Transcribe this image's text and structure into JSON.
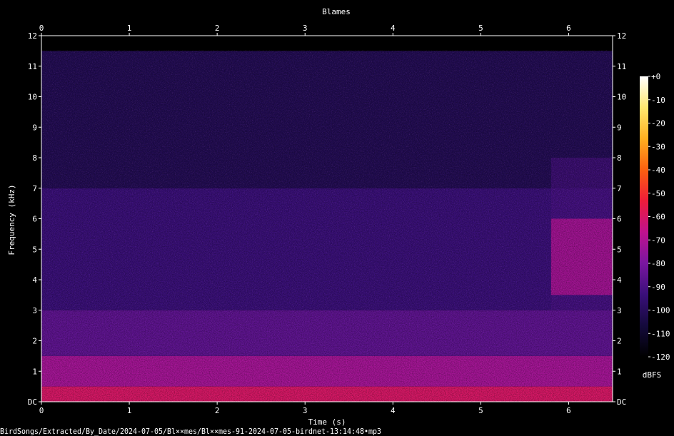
{
  "chart_data": {
    "type": "heatmap",
    "title": "Blames",
    "xlabel": "Time (s)",
    "ylabel": "Frequency (kHz)",
    "xlim": [
      0,
      6.5
    ],
    "ylim": [
      0,
      12
    ],
    "x_ticks": [
      {
        "value": 0,
        "label": "0"
      },
      {
        "value": 1,
        "label": "1"
      },
      {
        "value": 2,
        "label": "2"
      },
      {
        "value": 3,
        "label": "3"
      },
      {
        "value": 4,
        "label": "4"
      },
      {
        "value": 5,
        "label": "5"
      },
      {
        "value": 6,
        "label": "6"
      }
    ],
    "y_ticks": [
      {
        "value": 0,
        "label": "DC"
      },
      {
        "value": 1,
        "label": "1"
      },
      {
        "value": 2,
        "label": "2"
      },
      {
        "value": 3,
        "label": "3"
      },
      {
        "value": 4,
        "label": "4"
      },
      {
        "value": 5,
        "label": "5"
      },
      {
        "value": 6,
        "label": "6"
      },
      {
        "value": 7,
        "label": "7"
      },
      {
        "value": 8,
        "label": "8"
      },
      {
        "value": 9,
        "label": "9"
      },
      {
        "value": 10,
        "label": "10"
      },
      {
        "value": 11,
        "label": "11"
      },
      {
        "value": 12,
        "label": "12"
      }
    ],
    "colorbar": {
      "unit": "dBFS",
      "range": [
        -120,
        0
      ],
      "ticks": [
        {
          "value": 0,
          "label": "+0"
        },
        {
          "value": -10,
          "label": "-10"
        },
        {
          "value": -20,
          "label": "-20"
        },
        {
          "value": -30,
          "label": "-30"
        },
        {
          "value": -40,
          "label": "-40"
        },
        {
          "value": -50,
          "label": "-50"
        },
        {
          "value": -60,
          "label": "-60"
        },
        {
          "value": -70,
          "label": "-70"
        },
        {
          "value": -80,
          "label": "-80"
        },
        {
          "value": -90,
          "label": "-90"
        },
        {
          "value": -100,
          "label": "-100"
        },
        {
          "value": -110,
          "label": "-110"
        },
        {
          "value": -120,
          "label": "-120"
        }
      ],
      "colors": [
        "#000000",
        "#140a3c",
        "#3a0f7a",
        "#7a16a0",
        "#c0128e",
        "#ee1c3a",
        "#fb6010",
        "#ffb020",
        "#ffe870",
        "#ffffff"
      ]
    },
    "frequency_cutoff_khz": 11.5,
    "intensity_bands": [
      {
        "freq_khz": [
          0,
          0.5
        ],
        "level_db": -60
      },
      {
        "freq_khz": [
          0.5,
          1.5
        ],
        "level_db": -72
      },
      {
        "freq_khz": [
          1.5,
          3
        ],
        "level_db": -86
      },
      {
        "freq_khz": [
          3,
          7
        ],
        "level_db": -94
      },
      {
        "freq_khz": [
          7,
          11.5
        ],
        "level_db": -102
      }
    ],
    "call_region": {
      "time_s": [
        5.8,
        6.5
      ],
      "freq_khz": [
        3,
        8
      ],
      "peak_freq_khz": [
        3.5,
        6
      ],
      "level_db": -70
    }
  },
  "footer": {
    "file_path": "BirdSongs/Extracted/By_Date/2024-07-05/Bl××mes/Bl××mes-91-2024-07-05-birdnet-13:14:48•mp3"
  }
}
